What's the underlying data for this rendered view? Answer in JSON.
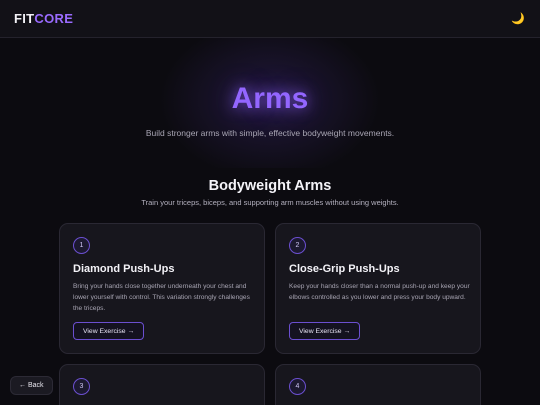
{
  "header": {
    "logo_part1": "FIT",
    "logo_part2": "CORE",
    "theme_icon": "moon-icon",
    "theme_glyph": "🌙"
  },
  "hero": {
    "title": "Arms",
    "subtitle": "Build stronger arms with simple, effective bodyweight movements."
  },
  "section": {
    "title": "Bodyweight Arms",
    "subtitle": "Train your triceps, biceps, and supporting arm muscles without using weights."
  },
  "exercises": [
    {
      "number": "1",
      "title": "Diamond Push-Ups",
      "description": "Bring your hands close together underneath your chest and lower yourself with control. This variation strongly challenges the triceps.",
      "button_label": "View Exercise →"
    },
    {
      "number": "2",
      "title": "Close-Grip Push-Ups",
      "description": "Keep your hands closer than a normal push-up and keep your elbows controlled as you lower and press your body upward.",
      "button_label": "View Exercise →"
    },
    {
      "number": "3"
    },
    {
      "number": "4"
    }
  ],
  "back_label": "← Back",
  "colors": {
    "accent": "#9366ff",
    "background": "#0c0b10",
    "card": "#17161d"
  }
}
